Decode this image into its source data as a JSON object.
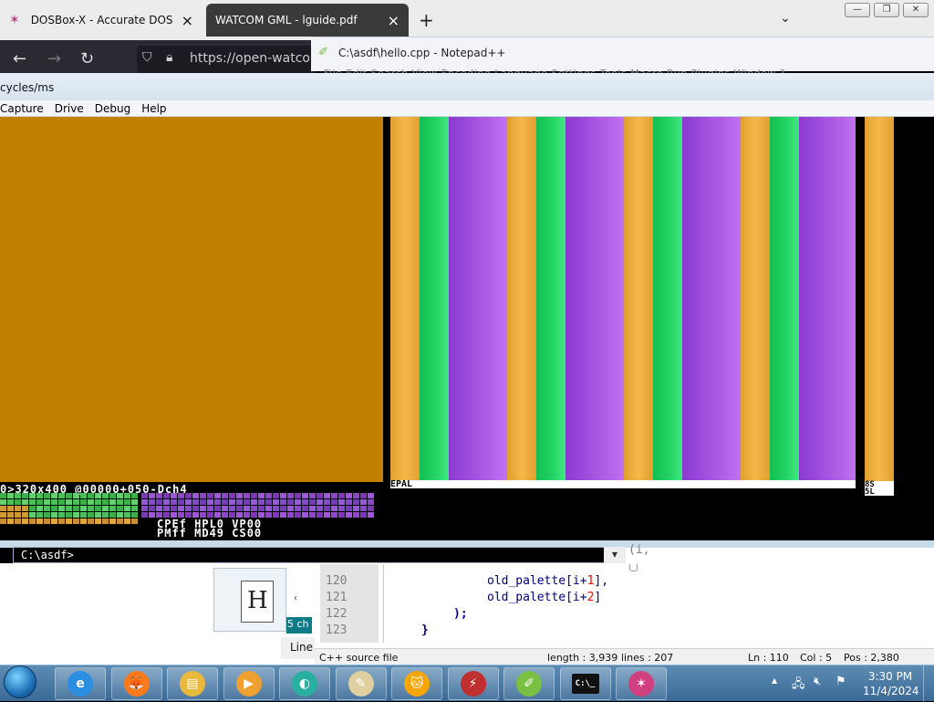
{
  "browser": {
    "tabs": [
      {
        "title": "DOSBox-X - Accurate DOS emu",
        "active": false
      },
      {
        "title": "WATCOM GML - lguide.pdf",
        "active": true
      }
    ],
    "new_tab": "+",
    "tab_list": "⌄",
    "url": "https://open-watcom",
    "nav": {
      "back": "←",
      "forward": "→",
      "reload": "↻"
    }
  },
  "window_controls": {
    "minimize": "—",
    "restore": "❐",
    "close": "✕"
  },
  "notepadpp": {
    "title": "C:\\asdf\\hello.cpp - Notepad++",
    "menu_peek": "File   Edit   Search   View   Encoding   Language   Settings   Tools   Macro   Run   Plugins   Window   ?",
    "gutter_lines": [
      "120",
      "121",
      "122",
      "123"
    ],
    "code": {
      "top_partial": "(i,",
      "line120": {
        "prefix": "old_palette[i+",
        "num": "1",
        "suffix": "],"
      },
      "line121": {
        "prefix": "old_palette[i+",
        "num": "2",
        "suffix": "]"
      },
      "line122": ");",
      "line123": "}"
    },
    "status": {
      "filetype": "C++ source file",
      "length": "length : 3,939",
      "lines": "lines : 207",
      "ln": "Ln : 110",
      "col": "Col : 5",
      "pos": "Pos : 2,380"
    }
  },
  "dosbox": {
    "title_partial": "cycles/ms",
    "menu": [
      "Capture",
      "Drive",
      "Debug",
      "Help"
    ],
    "debug_line1": "0>320x400 @00000+050-Dch4",
    "debug_pal_label": "EPAL",
    "debug_right": "8S\n5L",
    "debug_regs": "CPEf HPL0 VP00\nPMff MD49 CS00",
    "stripe_colors": [
      "#e0a030",
      "#20d060",
      "#8a3ad0",
      "#c070f0"
    ],
    "gold_color": "#c08000",
    "prompt": "C:\\asdf>"
  },
  "lower_left": {
    "teal_chip": "5 ch",
    "line_chip": "Line",
    "file_letter": "H"
  },
  "taskbar": {
    "items": [
      {
        "name": "ie-icon",
        "glyph": "e",
        "color": "#2b8ee0"
      },
      {
        "name": "firefox-icon",
        "glyph": "🦊",
        "color": "#ff7a1a"
      },
      {
        "name": "folder-icon",
        "glyph": "▤",
        "color": "#e8b93a"
      },
      {
        "name": "media-player-icon",
        "glyph": "▶",
        "color": "#f0a030"
      },
      {
        "name": "chat-app-icon",
        "glyph": "◐",
        "color": "#2ab0a0"
      },
      {
        "name": "paint-icon",
        "glyph": "✎",
        "color": "#e0d0a0"
      },
      {
        "name": "scratch-icon",
        "glyph": "🐱",
        "color": "#f7a700"
      },
      {
        "name": "winamp-icon",
        "glyph": "⚡",
        "color": "#c03030"
      },
      {
        "name": "notepadpp-icon",
        "glyph": "✐",
        "color": "#7ac043"
      },
      {
        "name": "cmd-icon",
        "glyph": "C:\\_",
        "color": "#111111"
      },
      {
        "name": "dosbox-icon",
        "glyph": "✶",
        "color": "#d04080"
      }
    ],
    "tray": {
      "time": "3:30 PM",
      "date": "11/4/2024",
      "expand": "▲"
    }
  }
}
